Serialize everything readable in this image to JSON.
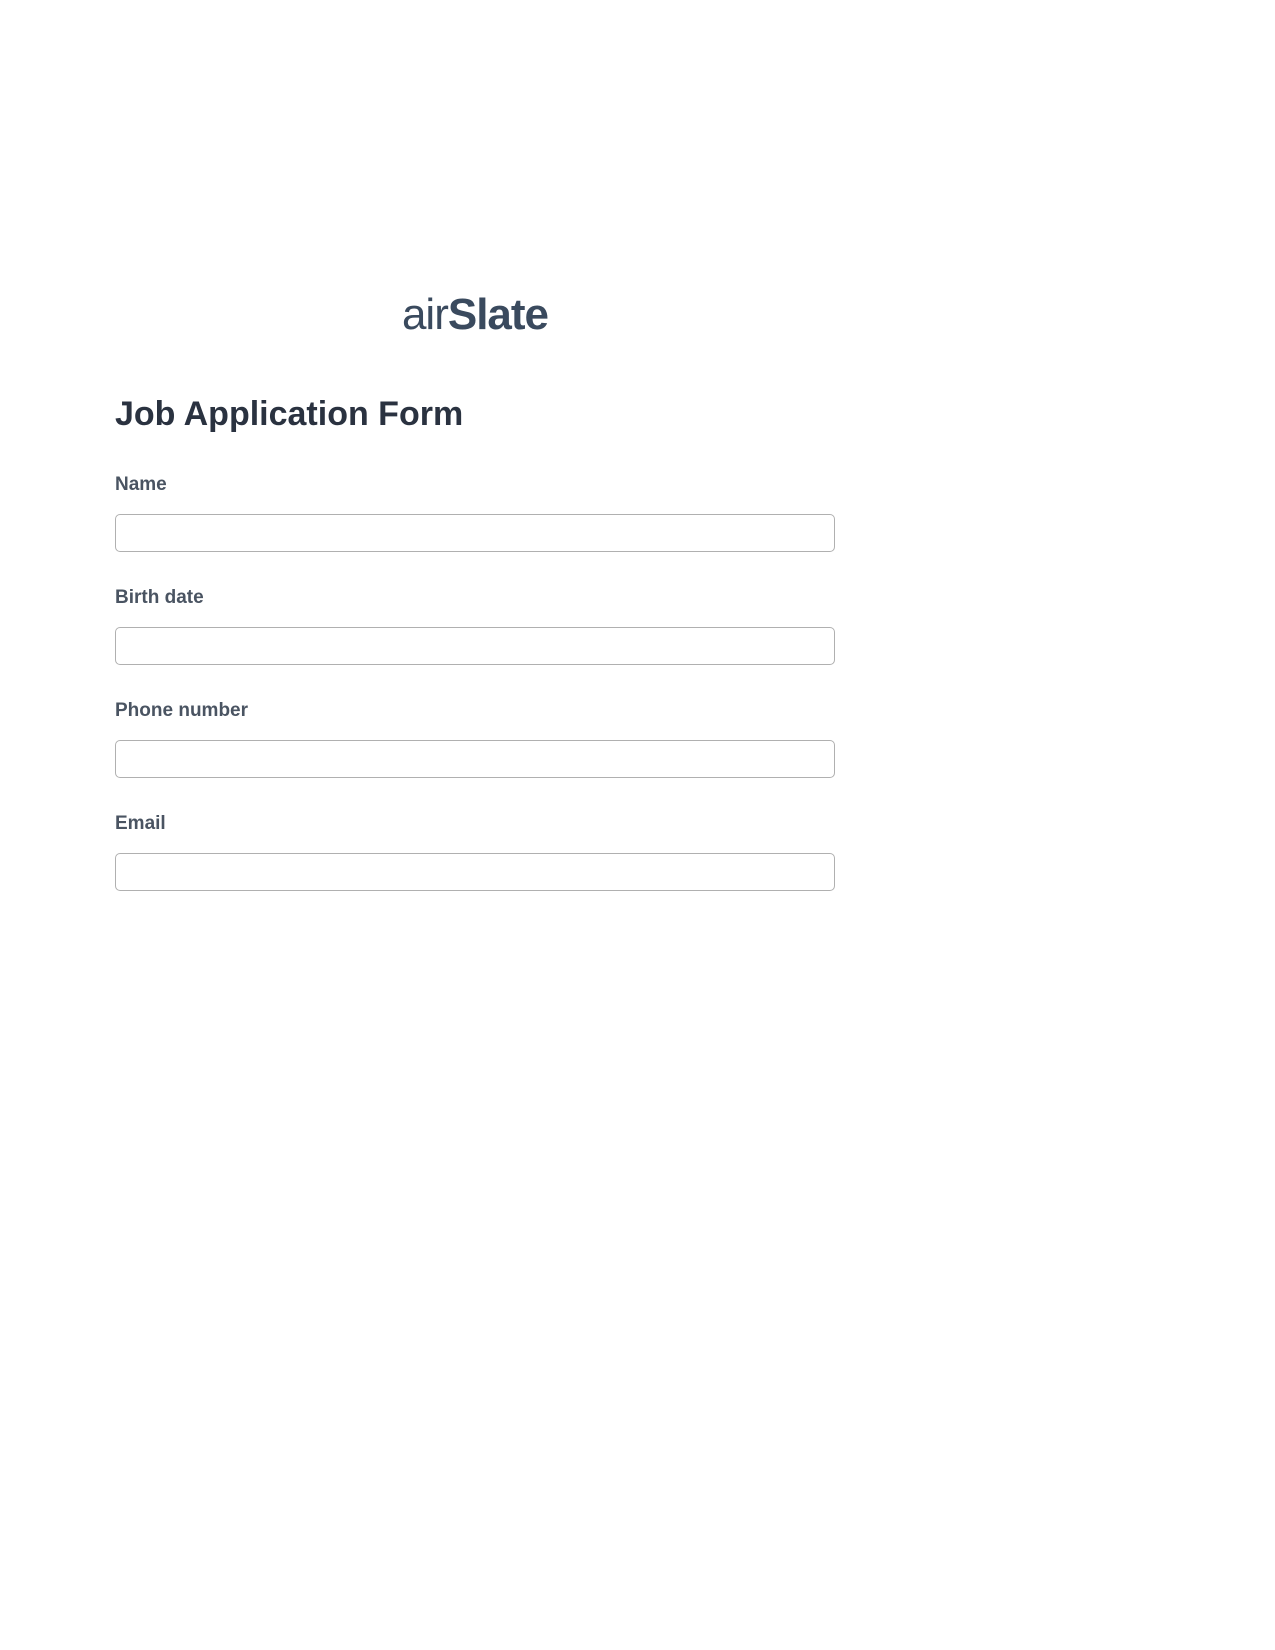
{
  "logo": {
    "part1": "air",
    "part2": "Slate"
  },
  "form": {
    "title": "Job Application Form",
    "fields": [
      {
        "label": "Name",
        "value": ""
      },
      {
        "label": "Birth date",
        "value": ""
      },
      {
        "label": "Phone number",
        "value": ""
      },
      {
        "label": "Email",
        "value": ""
      }
    ]
  }
}
